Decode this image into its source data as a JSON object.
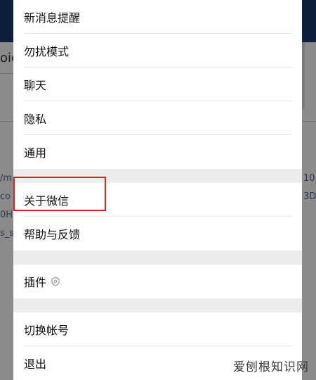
{
  "background_fragments": {
    "title_fragment": "oic",
    "link_fragments": [
      "/m",
      "co",
      "0H",
      "s_sh"
    ],
    "right_fragments": [
      "10",
      "3D"
    ]
  },
  "settings": {
    "group1": [
      "新消息提醒",
      "勿扰模式",
      "聊天",
      "隐私",
      "通用"
    ],
    "group2": [
      "关于微信",
      "帮助与反馈"
    ],
    "group3": {
      "label": "插件",
      "icon": "plugin-badge-icon"
    },
    "group4": [
      "切换帐号",
      "退出"
    ]
  },
  "highlighted_item": "关于微信",
  "watermark": "爱刨根知识网",
  "colors": {
    "highlight_border": "#e02020",
    "sheet_background": "#ededed",
    "item_background": "#ffffff"
  }
}
